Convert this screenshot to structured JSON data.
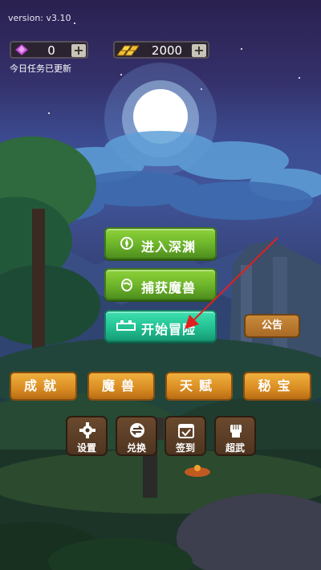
{
  "version": "version: v3.10",
  "currency": {
    "gems": "0",
    "gold": "2000",
    "plus": "+"
  },
  "task_status": "今日任务已更新",
  "main_buttons": [
    {
      "label": "进入深渊",
      "icon": "abyss-portal-icon"
    },
    {
      "label": "捕获魔兽",
      "icon": "capture-egg-icon"
    },
    {
      "label": "开始冒险",
      "icon": "adventure-icon"
    }
  ],
  "notice_label": "公告",
  "category_tabs": [
    {
      "label": "成就"
    },
    {
      "label": "魔兽"
    },
    {
      "label": "天赋"
    },
    {
      "label": "秘宝"
    }
  ],
  "bottom_buttons": [
    {
      "label": "设置",
      "icon": "gear-icon"
    },
    {
      "label": "兑换",
      "icon": "exchange-icon"
    },
    {
      "label": "签到",
      "icon": "calendar-check-icon"
    },
    {
      "label": "超武",
      "icon": "fist-icon"
    }
  ],
  "colors": {
    "primary_green": "#6cb42a",
    "adventure_teal": "#23c193",
    "tab_orange": "#d98c22",
    "gem_purple": "#c85ad8",
    "arrow_red": "#e02020"
  }
}
